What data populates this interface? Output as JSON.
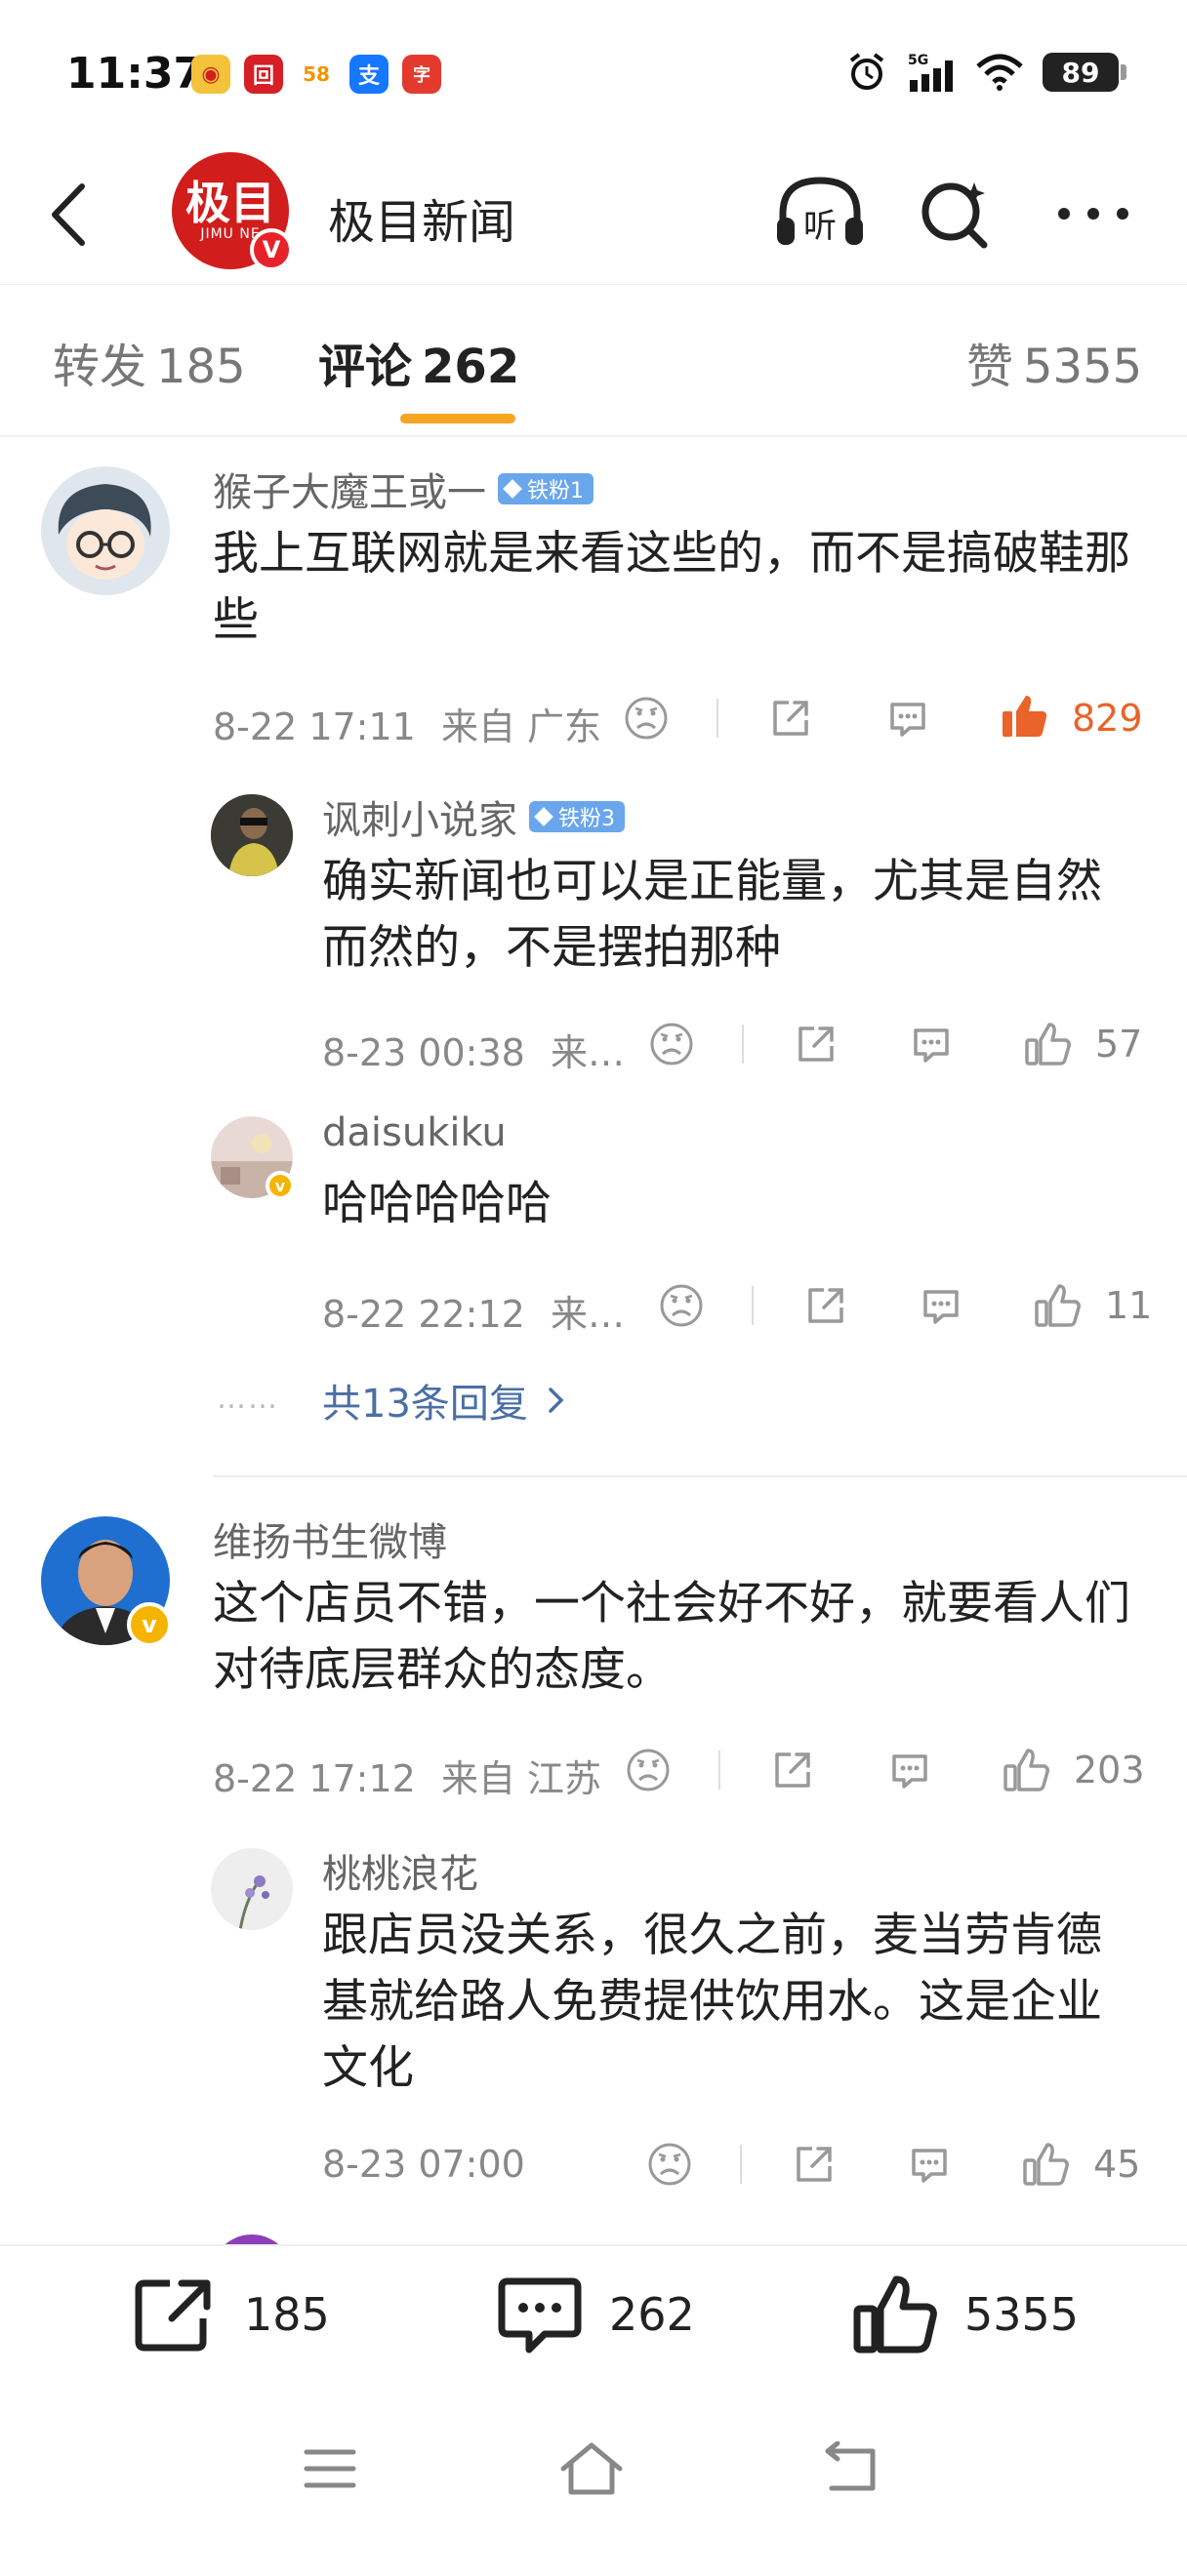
{
  "status_bar": {
    "time": "11:37",
    "battery": "89",
    "network": "5G",
    "app_icons": [
      {
        "name": "weibo-icon",
        "glyph": "◉",
        "color": "#f5c33b"
      },
      {
        "name": "bank-icon",
        "glyph": "回",
        "color": "#d61f26"
      },
      {
        "name": "58-icon",
        "glyph": "58",
        "color": "#ffffff"
      },
      {
        "name": "alipay-icon",
        "glyph": "支",
        "color": "#1677ff"
      },
      {
        "name": "news-app-icon",
        "glyph": "字",
        "color": "#e33a2d"
      }
    ]
  },
  "header": {
    "title": "极目新闻",
    "logo_text": "极目",
    "logo_sub": "JIMU NE",
    "listen_label": "听"
  },
  "tabs": {
    "repost": {
      "label": "转发",
      "count": "185"
    },
    "comment": {
      "label": "评论",
      "count": "262"
    },
    "like": {
      "label": "赞",
      "count": "5355"
    }
  },
  "comments": [
    {
      "user": "猴子大魔王或一",
      "fan_badge": "铁粉1",
      "text": "我上互联网就是来看这些的，而不是搞破鞋那些",
      "date": "8-22 17:11",
      "location": "来自 广东",
      "likes": "829",
      "liked": true,
      "replies": [
        {
          "user": "讽刺小说家",
          "fan_badge": "铁粉3",
          "text": "确实新闻也可以是正能量，尤其是自然而然的，不是摆拍那种",
          "date": "8-23 00:38",
          "location": "来…",
          "likes": "57"
        },
        {
          "user": "daisukiku",
          "text": "哈哈哈哈哈",
          "date": "8-22 22:12",
          "location": "来…",
          "likes": "11"
        }
      ],
      "more_replies": "共13条回复",
      "more_dots": "……"
    },
    {
      "user": "维扬书生微博",
      "text": "这个店员不错，一个社会好不好，就要看人们对待底层群众的态度。",
      "date": "8-22 17:12",
      "location": "来自 江苏",
      "likes": "203",
      "replies": [
        {
          "user": "桃桃浪花",
          "text": "跟店员没关系，很久之前，麦当劳肯德基就给路人免费提供饮用水。这是企业文化",
          "date": "8-23 07:00",
          "likes": "45"
        }
      ]
    }
  ],
  "bottom_bar": {
    "repost_count": "185",
    "comment_count": "262",
    "like_count": "5355"
  },
  "colors": {
    "accent": "#f5a623",
    "liked": "#e9632a",
    "link": "#4a6fa5",
    "fan_badge": "#6aa6ec"
  }
}
